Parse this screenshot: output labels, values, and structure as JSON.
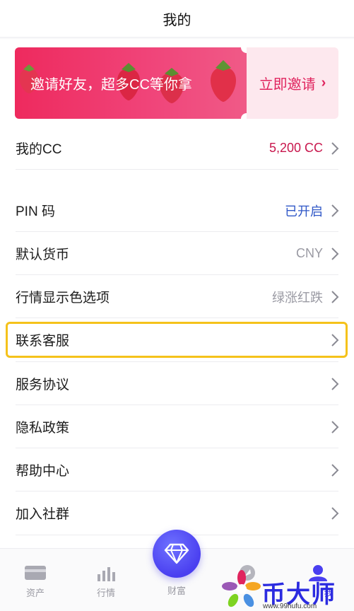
{
  "header": {
    "title": "我的"
  },
  "banner": {
    "text": "邀请好友，超多CC等你拿",
    "action_label": "立即邀请",
    "action_chevron": "›"
  },
  "rows": [
    {
      "label": "我的CC",
      "value": "5,200 CC",
      "value_color": "#c8174d"
    },
    {
      "label": "PIN 码",
      "value": "已开启",
      "value_color": "#2f57c7"
    },
    {
      "label": "默认货币",
      "value": "CNY",
      "value_color": "#9a9aa3"
    },
    {
      "label": "行情显示色选项",
      "value": "绿涨红跌",
      "value_color": "#9a9aa3"
    },
    {
      "label": "联系客服",
      "value": ""
    },
    {
      "label": "服务协议",
      "value": ""
    },
    {
      "label": "隐私政策",
      "value": ""
    },
    {
      "label": "帮助中心",
      "value": ""
    },
    {
      "label": "加入社群",
      "value": ""
    }
  ],
  "tabbar": {
    "tabs": [
      {
        "label": "资产",
        "icon": "wallet-icon"
      },
      {
        "label": "行情",
        "icon": "bar-chart-icon"
      },
      {
        "label": "财富",
        "icon": "diamond-icon"
      },
      {
        "label": "我",
        "icon": "user-icon"
      }
    ]
  },
  "watermark": {
    "name": "币大师",
    "url": "www.99hufu.com"
  },
  "colors": {
    "accent_pink": "#ee2a5e",
    "highlight": "#f5c21b",
    "tab_center": "#4a3ff0"
  }
}
